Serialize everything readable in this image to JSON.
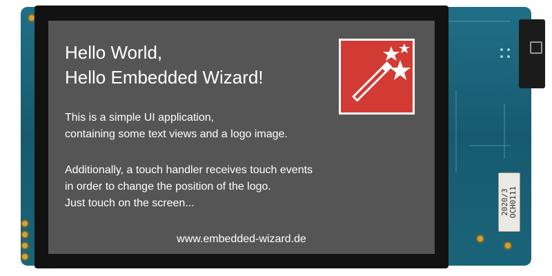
{
  "screen": {
    "headline_line1": "Hello World,",
    "headline_line2": "Hello Embedded Wizard!",
    "paragraph1_line1": "This is a simple UI application,",
    "paragraph1_line2": "containing some text views and a logo image.",
    "paragraph2_line1": "Additionally, a touch handler receives touch events",
    "paragraph2_line2": "in order to change the position of the logo.",
    "paragraph2_line3": "Just touch on the screen...",
    "url": "www.embedded-wizard.de",
    "logo_icon": "magic-wand-stars-icon",
    "background_color": "#555555",
    "logo_color": "#d23b33"
  },
  "board": {
    "sticker_line1": "2020/3",
    "sticker_line2": "OCH0111"
  }
}
